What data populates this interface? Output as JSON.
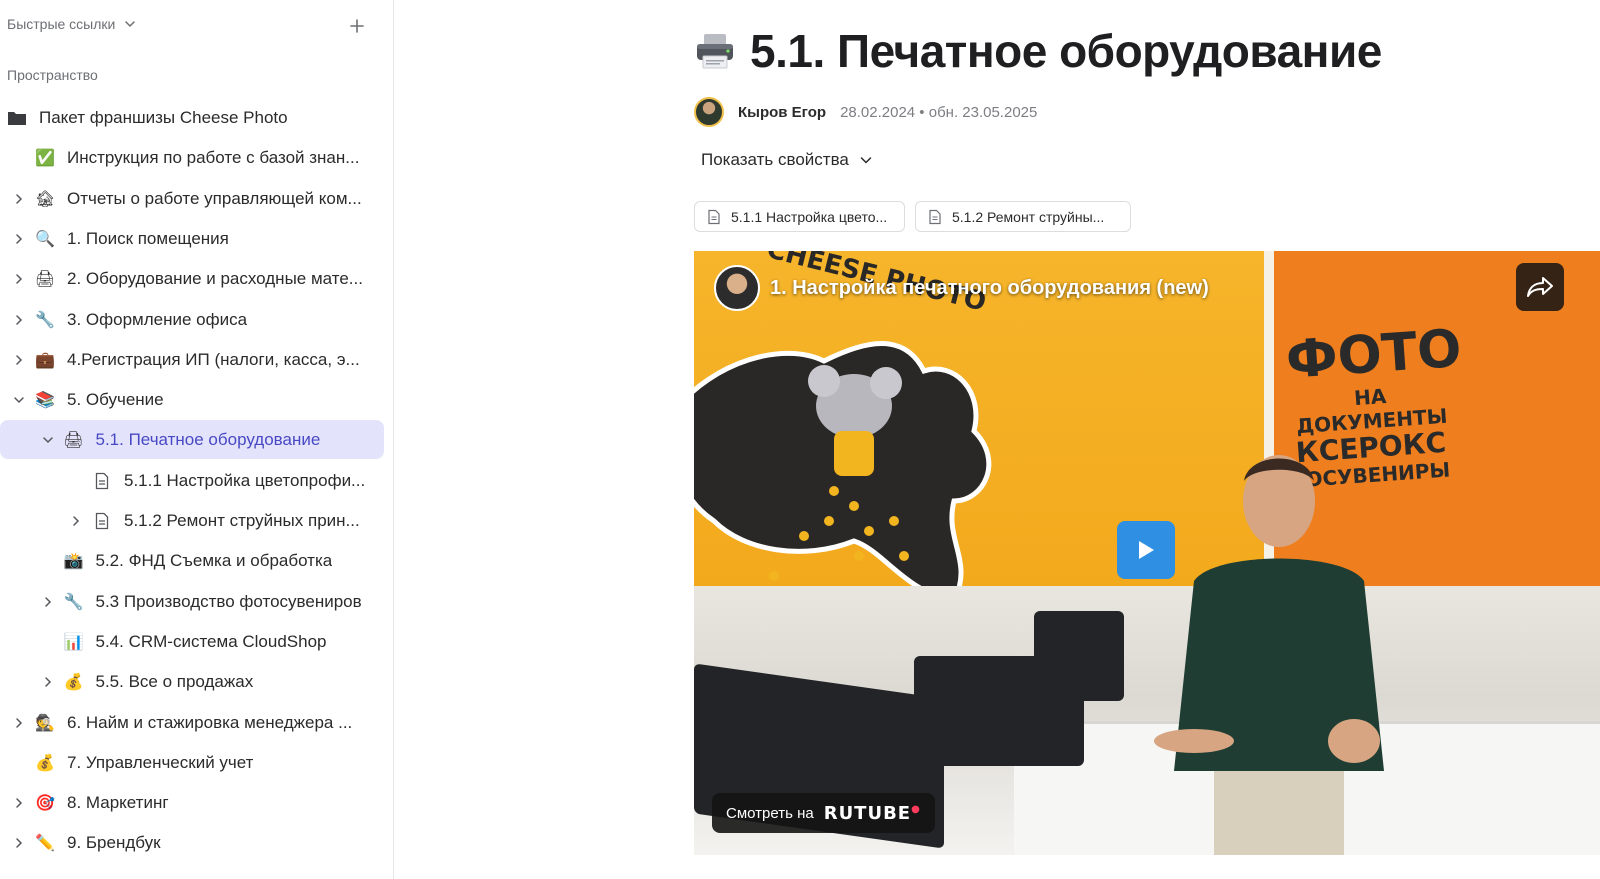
{
  "sidebar": {
    "quick_links_label": "Быстрые ссылки",
    "space_label": "Пространство",
    "items": [
      {
        "label": "Пакет франшизы Cheese Photo",
        "icon": "folder-icon",
        "emoji": "🗂",
        "expandable": false
      },
      {
        "label": "Инструкция по работе с базой знан...",
        "icon": "check-icon",
        "emoji": "✅",
        "expandable": false
      },
      {
        "label": "Отчеты о работе управляющей ком...",
        "icon": "house-icon",
        "emoji": "🏚",
        "expandable": true
      },
      {
        "label": "1. Поиск помещения",
        "icon": "magnifier-icon",
        "emoji": "🔍",
        "expandable": true
      },
      {
        "label": "2. Оборудование и расходные мате...",
        "icon": "printer-icon",
        "emoji": "🖨",
        "expandable": true
      },
      {
        "label": "3. Оформление офиса",
        "icon": "wrench-icon",
        "emoji": "🔧",
        "expandable": true
      },
      {
        "label": "4.Регистрация ИП (налоги, касса, э...",
        "icon": "briefcase-icon",
        "emoji": "💼",
        "expandable": true
      },
      {
        "label": "5. Обучение",
        "icon": "books-icon",
        "emoji": "📚",
        "expandable": true,
        "expanded": true
      },
      {
        "label": "5.1. Печатное оборудование",
        "icon": "printer-icon",
        "emoji": "🖨",
        "expandable": true,
        "expanded": true,
        "active": true
      },
      {
        "label": "5.1.1 Настройка цветопрофи...",
        "icon": "document-icon",
        "emoji": "",
        "expandable": false
      },
      {
        "label": "5.1.2 Ремонт струйных прин...",
        "icon": "document-icon",
        "emoji": "",
        "expandable": true
      },
      {
        "label": "5.2. ФНД Съемка и обработка",
        "icon": "camera-icon",
        "emoji": "📸",
        "expandable": false
      },
      {
        "label": "5.3 Производство фотосувениров",
        "icon": "wrench-icon",
        "emoji": "🔧",
        "expandable": true
      },
      {
        "label": "5.4. CRM-система CloudShop",
        "icon": "bar-chart-icon",
        "emoji": "📊",
        "expandable": false
      },
      {
        "label": "5.5. Все о продажах",
        "icon": "money-bag-icon",
        "emoji": "💰",
        "expandable": true
      },
      {
        "label": "6. Найм и стажировка менеджера ...",
        "icon": "detective-icon",
        "emoji": "🕵",
        "expandable": true
      },
      {
        "label": "7. Управленческий учет",
        "icon": "money-bag-icon",
        "emoji": "💰",
        "expandable": false
      },
      {
        "label": "8. Маркетинг",
        "icon": "target-icon",
        "emoji": "🎯",
        "expandable": true
      },
      {
        "label": "9. Брендбук",
        "icon": "pencil-icon",
        "emoji": "✏️",
        "expandable": true
      }
    ]
  },
  "page": {
    "title_icon": "printer-icon",
    "title": "5.1. Печатное оборудование",
    "author": "Кыров Егор",
    "meta": "28.02.2024 • обн. 23.05.2025",
    "show_properties": "Показать свойства",
    "chips": [
      {
        "label": "5.1.1 Настройка цвето...",
        "icon": "document-icon"
      },
      {
        "label": "5.1.2 Ремонт струйны...",
        "icon": "document-icon"
      }
    ]
  },
  "video": {
    "title": "1. Настройка печатного оборудования (new)",
    "watch_on": "Смотреть на",
    "brand": "RUTUBE",
    "sign_big": "ФОТО",
    "sign_line1": "НА ДОКУМЕНТЫ",
    "sign_line2": "КСЕРОКС",
    "sign_line3": "ТОСУВЕНИРЫ",
    "wall_text": "CHEESE PHOTO"
  },
  "colors": {
    "active_bg": "#e3e4fb",
    "active_text": "#4848c4",
    "play_button": "#2f8fe3",
    "rutube_accent": "#ff3b5c"
  }
}
